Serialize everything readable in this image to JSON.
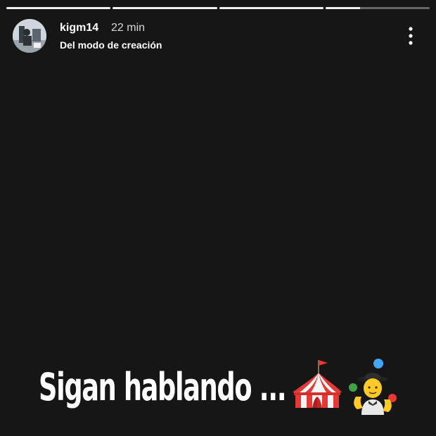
{
  "story": {
    "progress": [
      1,
      1,
      1,
      0.33
    ],
    "user": {
      "username": "kigm14",
      "time": "22 min",
      "subtitle": "Del modo de creación",
      "avatar_icon": "profile-photo"
    },
    "menu_icon": "more-vertical-icon",
    "caption": {
      "text": "Sigan hablando ...",
      "emojis": [
        "circus-tent-icon",
        "person-juggling-icon"
      ]
    }
  },
  "colors": {
    "background": "#161617",
    "text": "#ffffff",
    "progress_active": "#f2f2f2",
    "progress_inactive": "rgba(255,255,255,0.35)"
  }
}
